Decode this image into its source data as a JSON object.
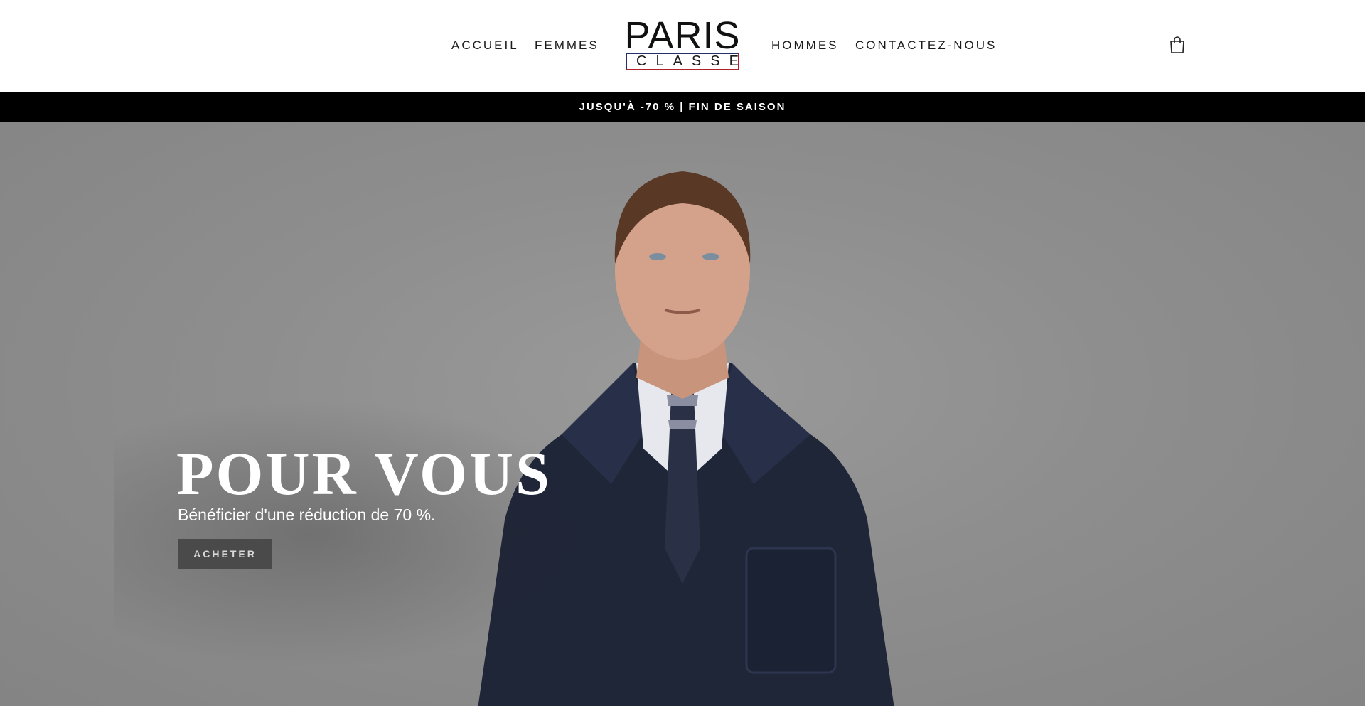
{
  "header": {
    "nav_left": [
      {
        "label": "ACCUEIL"
      },
      {
        "label": "FEMMES"
      }
    ],
    "nav_right": [
      {
        "label": "HOMMES"
      },
      {
        "label": "CONTACTEZ-NOUS"
      }
    ],
    "logo": {
      "top": "PARIS",
      "bottom": "CLASSE",
      "colors": {
        "blue": "#22306e",
        "red": "#b0202d"
      }
    },
    "cart_icon": "shopping-bag-icon"
  },
  "announcement": {
    "text": "JUSQU'À -70 % | FIN DE SAISON"
  },
  "hero": {
    "title": "POUR VOUS",
    "subtitle": "Bénéficier d'une réduction de 70 %.",
    "button_label": "ACHETER",
    "image": "model-in-navy-coat"
  },
  "colors": {
    "announcement_bg": "#000000",
    "hero_bg": "#8f8f8f",
    "button_bg": "#4a4a4a"
  }
}
